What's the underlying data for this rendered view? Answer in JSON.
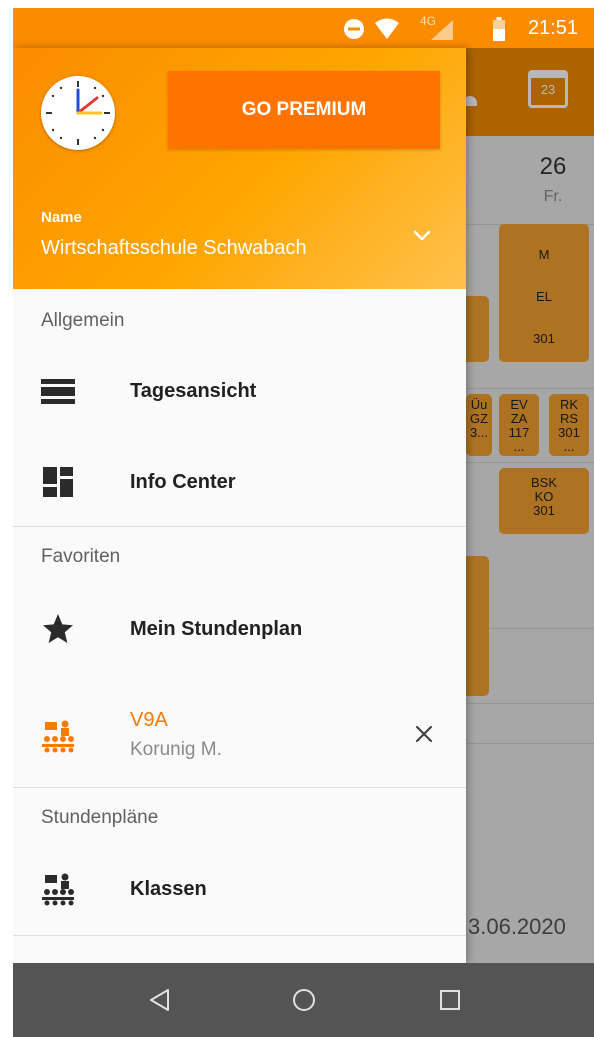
{
  "status_bar": {
    "network_label": "4G",
    "time": "21:51",
    "icons": [
      "do-not-disturb-icon",
      "wifi-icon",
      "cellular-signal-icon",
      "battery-icon"
    ]
  },
  "background_app": {
    "calendar_day": "23",
    "day_number": "26",
    "day_name": "Fr.",
    "cards": [
      {
        "lines": [
          "M",
          "EL",
          "301"
        ]
      },
      {
        "lines": [
          "Üu",
          "GZ",
          "3..."
        ]
      },
      {
        "lines": [
          "EV",
          "ZA",
          "117",
          "..."
        ]
      },
      {
        "lines": [
          "RK",
          "RS",
          "301",
          "..."
        ]
      },
      {
        "lines": [
          "BSK",
          "KO",
          "301"
        ]
      }
    ],
    "date_fragment": "3.06.2020"
  },
  "drawer": {
    "header": {
      "premium_label": "GO PREMIUM",
      "name_label": "Name",
      "name_value": "Wirtschaftsschule Schwabach"
    },
    "sections": {
      "general": "Allgemein",
      "favorites": "Favoriten",
      "timetables": "Stundenpläne"
    },
    "items": {
      "day_view": "Tagesansicht",
      "info_center": "Info Center",
      "my_timetable": "Mein Stundenplan",
      "classes": "Klassen"
    },
    "favorite": {
      "title": "V9A",
      "subtitle": "Korunig M."
    }
  },
  "colors": {
    "accent": "#f57c00",
    "premium_button": "#ff7400",
    "status_bar": "#fb8c00",
    "nav_bar": "#545454"
  }
}
